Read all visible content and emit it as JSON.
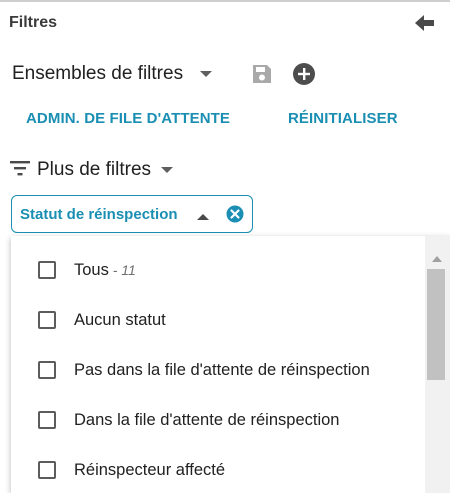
{
  "header": {
    "title": "Filtres",
    "back_icon": "arrow-left-icon"
  },
  "filter_sets": {
    "label": "Ensembles de filtres",
    "save_icon": "save-icon",
    "add_icon": "add-circle-icon"
  },
  "actions": {
    "admin_label": "ADMIN. DE FILE D'ATTENTE",
    "reset_label": "RÉINITIALISER"
  },
  "more_filters": {
    "label": "Plus de filtres",
    "icon": "filter-list-icon"
  },
  "chip": {
    "label": "Statut de réinspection",
    "clear_icon": "clear-circle-icon"
  },
  "options": [
    {
      "label": "Tous",
      "count": " - 11",
      "checked": false
    },
    {
      "label": "Aucun statut",
      "checked": false
    },
    {
      "label": "Pas dans la file d'attente de réinspection",
      "checked": false
    },
    {
      "label": "Dans la file d'attente de réinspection",
      "checked": false
    },
    {
      "label": "Réinspecteur affecté",
      "checked": false
    }
  ],
  "colors": {
    "accent": "#1a8fb3",
    "text": "#212121",
    "icon_grey": "#5f5f5f"
  }
}
